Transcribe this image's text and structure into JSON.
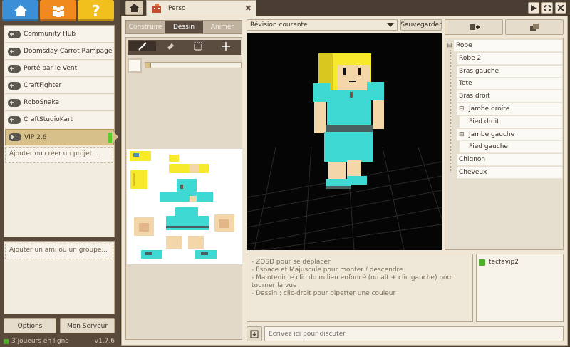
{
  "nav": {
    "home_icon": "home-icon",
    "community_icon": "people-icon",
    "help_icon": "question-icon",
    "help_glyph": "?",
    "colors": {
      "home": "#3a8fd6",
      "community": "#f08a1e",
      "help": "#f2c01c"
    }
  },
  "projects": [
    {
      "label": "Community Hub"
    },
    {
      "label": "Doomsday Carrot Rampage"
    },
    {
      "label": "Porté par le Vent"
    },
    {
      "label": "CraftFighter"
    },
    {
      "label": "RoboSnake"
    },
    {
      "label": "CraftStudioKart"
    },
    {
      "label": "VIP 2.6"
    }
  ],
  "add_project": "Ajouter ou créer un projet...",
  "add_friend": "Ajouter un ami ou un groupe...",
  "options_label": "Options",
  "server_label": "Mon Serveur",
  "status": {
    "players": "3 joueurs en ligne",
    "version": "v1.7.6"
  },
  "tab": {
    "label": "Perso"
  },
  "window_controls": [
    "play-icon",
    "restore-icon",
    "close-icon"
  ],
  "modes": {
    "construire": "Construire",
    "dessin": "Dessin",
    "animer": "Animer"
  },
  "tools": [
    "brush-icon",
    "eraser-icon",
    "select-icon",
    "move-icon"
  ],
  "revision": {
    "label": "Révision courante",
    "save": "Sauvegarder"
  },
  "tree": [
    {
      "label": "Robe",
      "indent": 0,
      "expander": "⊟"
    },
    {
      "label": "Robe 2",
      "indent": 1
    },
    {
      "label": "Bras gauche",
      "indent": 1
    },
    {
      "label": "Tete",
      "indent": 1
    },
    {
      "label": "Bras droit",
      "indent": 1
    },
    {
      "label": "Jambe droite",
      "indent": 1,
      "expander": "⊟"
    },
    {
      "label": "Pied droit",
      "indent": 2
    },
    {
      "label": "Jambe gauche",
      "indent": 1,
      "expander": "⊟"
    },
    {
      "label": "Pied gauche",
      "indent": 2
    },
    {
      "label": "Chignon",
      "indent": 1
    },
    {
      "label": "Cheveux",
      "indent": 1
    }
  ],
  "hints": [
    "- ZQSD pour se déplacer",
    "- Espace et Majuscule pour monter / descendre",
    "- Maintenir le clic du milieu enfoncé (ou alt + clic gauche) pour",
    "tourner la vue",
    "- Dessin : clic-droit pour pipetter une couleur"
  ],
  "users": [
    {
      "name": "tecfavip2",
      "status_color": "#4caf28"
    }
  ],
  "chat_placeholder": "Écrivez ici pour discuter"
}
